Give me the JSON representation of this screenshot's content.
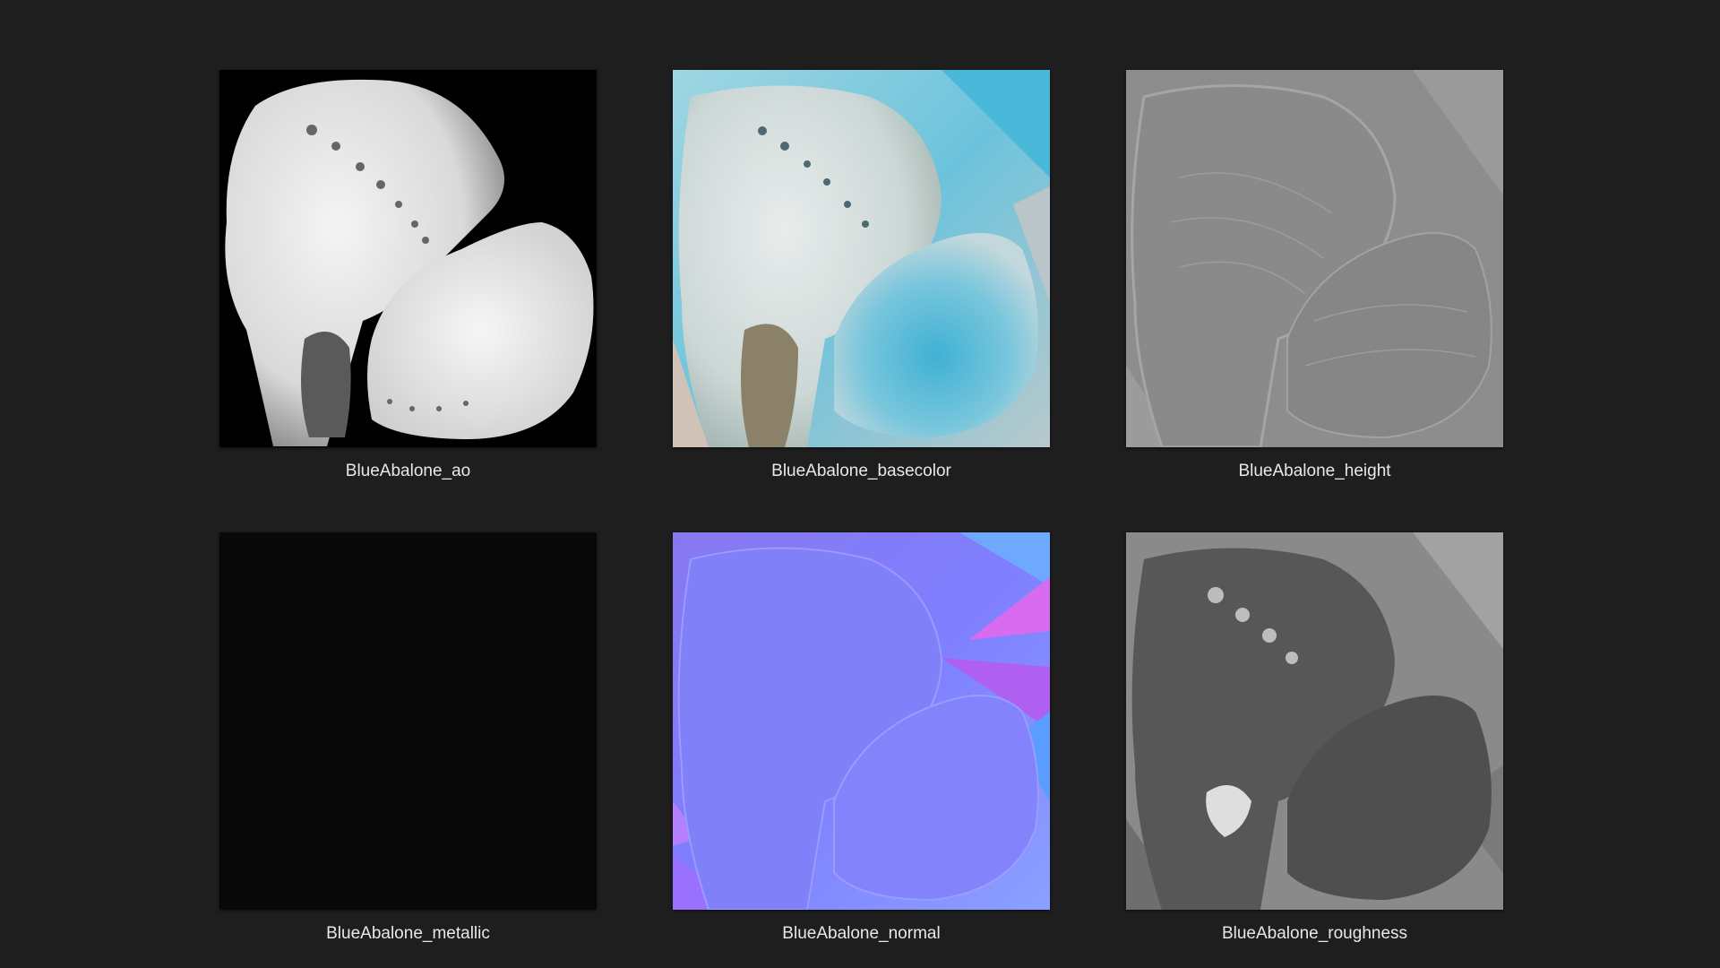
{
  "colors": {
    "background": "#1e1e1e",
    "label": "#e8e8e8",
    "ao_bg": "#000000",
    "metallic_bg": "#080808",
    "normal_base": "#7f7fff"
  },
  "files": [
    {
      "label": "BlueAbalone_ao",
      "icon": "ao-texture-thumbnail"
    },
    {
      "label": "BlueAbalone_basecolor",
      "icon": "basecolor-texture-thumbnail"
    },
    {
      "label": "BlueAbalone_height",
      "icon": "height-texture-thumbnail"
    },
    {
      "label": "BlueAbalone_metallic",
      "icon": "metallic-texture-thumbnail"
    },
    {
      "label": "BlueAbalone_normal",
      "icon": "normal-texture-thumbnail"
    },
    {
      "label": "BlueAbalone_roughness",
      "icon": "roughness-texture-thumbnail"
    }
  ]
}
